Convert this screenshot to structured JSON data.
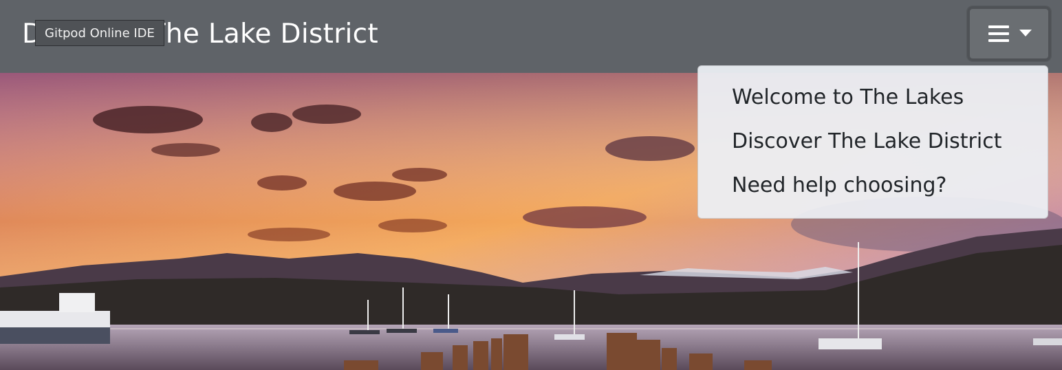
{
  "navbar": {
    "brand_title": "Discover The Lake District",
    "tooltip": "Gitpod Online IDE",
    "toggler_icon": "hamburger-icon",
    "toggler_caret_icon": "caret-down-icon",
    "background_color": "#5f6368"
  },
  "dropdown": {
    "items": [
      {
        "label": "Welcome to The Lakes"
      },
      {
        "label": "Discover The Lake District"
      },
      {
        "label": "Need help choosing?"
      }
    ]
  },
  "hero": {
    "description_icon": "lake-sunset-photo"
  }
}
